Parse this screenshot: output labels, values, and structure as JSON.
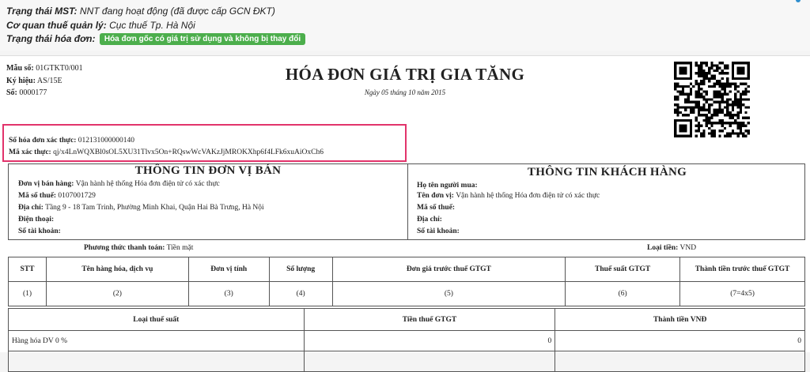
{
  "status": {
    "mst_label": "Trạng thái MST:",
    "mst_value": "NNT đang hoạt động (đã được cấp GCN ĐKT)",
    "authority_label": "Cơ quan thuế quản lý:",
    "authority_value": "Cục thuế Tp. Hà Nội",
    "invoice_status_label": "Trạng thái hóa đơn:",
    "invoice_status_badge": "Hóa đơn gốc có giá trị sử dụng và không bị thay đổi",
    "badge_color": "#4cae4c"
  },
  "invoice": {
    "template_label": "Mẫu số:",
    "template_value": "01GTKT0/001",
    "symbol_label": "Ký hiệu:",
    "symbol_value": "AS/15E",
    "number_label": "Số:",
    "number_value": "0000177",
    "title": "HÓA ĐƠN GIÁ TRỊ GIA TĂNG",
    "date": "Ngày 05 tháng 10 năm 2015",
    "verify_number_label": "Số hóa đơn xác thực:",
    "verify_number_value": "012131000000140",
    "verify_code_label": "Mã xác thực:",
    "verify_code_value": "qj/x4LnWQXBl0sOL5XU31Tlvx5On+RQswWcVAKzJjMROKXhp6f4LFk6xuAiOxCh6",
    "highlight_color": "#e2336b"
  },
  "seller": {
    "title": "THÔNG TIN ĐƠN VỊ BÁN",
    "unit_label": "Đơn vị bán hàng:",
    "unit_value": "Vận hành hệ thống Hóa đơn điện tử có xác thực",
    "tax_code_label": "Mã số thuế:",
    "tax_code_value": "0107001729",
    "address_label": "Địa chỉ:",
    "address_value": "Tầng 9 - 18 Tam Trinh, Phường Minh Khai, Quận Hai Bà Trưng, Hà Nội",
    "phone_label": "Điện thoại:",
    "account_label": "Số tài khoản:"
  },
  "buyer": {
    "title": "THÔNG TIN KHÁCH HÀNG",
    "name_label": "Họ tên người mua:",
    "unit_label": "Tên đơn vị:",
    "unit_value": "Vận hành hệ thống Hóa đơn điện tử có xác thực",
    "tax_code_label": "Mã số thuế:",
    "address_label": "Địa chỉ:",
    "account_label": "Số tài khoản:"
  },
  "payment": {
    "method_label": "Phương thức thanh toán:",
    "method_value": "Tiền mặt",
    "currency_label": "Loại tiền:",
    "currency_value": "VND"
  },
  "items_table": {
    "headers": [
      "STT",
      "Tên hàng hóa, dịch vụ",
      "Đơn vị tính",
      "Số lượng",
      "Đơn giá trước thuế GTGT",
      "Thuế suất GTGT",
      "Thành tiền trước thuế GTGT"
    ],
    "codes": [
      "(1)",
      "(2)",
      "(3)",
      "(4)",
      "(5)",
      "(6)",
      "(7=4x5)"
    ]
  },
  "tax_table": {
    "headers": [
      "Loại thuế suất",
      "Tiền thuế GTGT",
      "Thành tiền VNĐ"
    ],
    "rows": [
      {
        "type": "Hàng hóa DV 0 %",
        "tax": "0",
        "amount": "0"
      }
    ]
  }
}
